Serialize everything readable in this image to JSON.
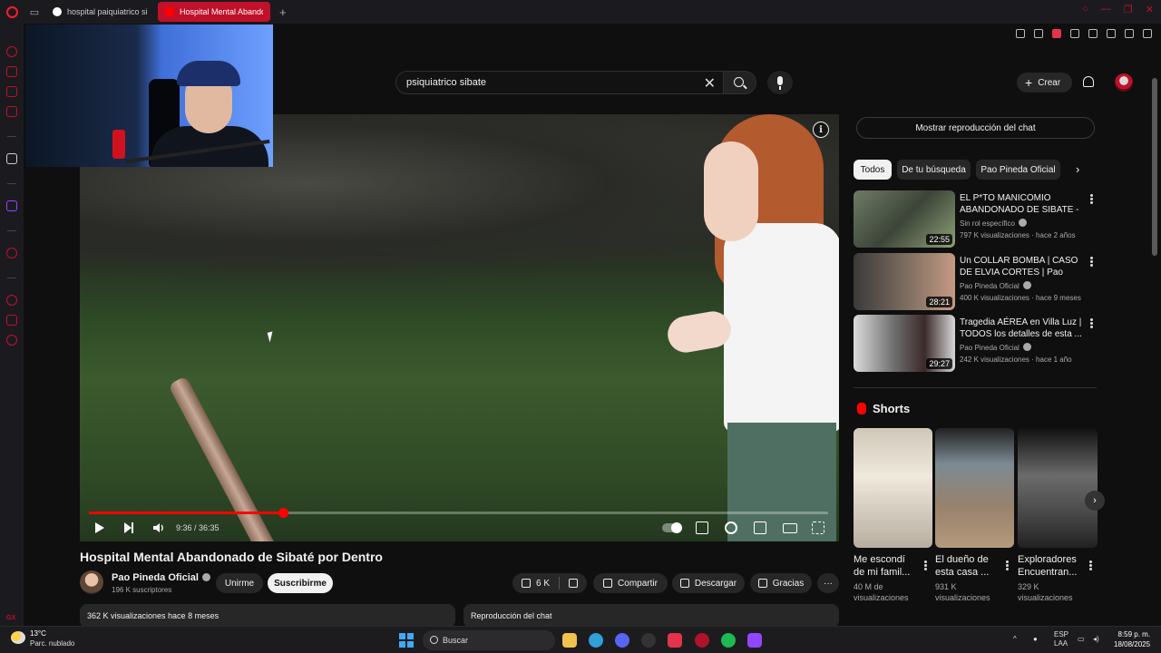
{
  "browser": {
    "tabs": [
      {
        "title": "hospital paiquiatrico siber",
        "active": false
      },
      {
        "title": "Hospital Mental Abandon",
        "active": true
      }
    ],
    "accent": "#c1102a"
  },
  "header": {
    "search_value": "psiquiatrico sibate",
    "create_label": "Crear"
  },
  "player": {
    "time_current": "9:36",
    "time_total": "36:35",
    "time_display": "9:36 / 36:35",
    "progress_fraction": 0.262
  },
  "video": {
    "title": "Hospital Mental Abandonado de Sibaté por Dentro",
    "channel": "Pao Pineda Oficial",
    "subscribers": "196 K suscriptores",
    "join_label": "Unirme",
    "subscribe_label": "Suscribirme",
    "likes": "6 K",
    "share_label": "Compartir",
    "download_label": "Descargar",
    "thanks_label": "Gracias",
    "description_meta": "362 K visualizaciones  hace 8 meses",
    "chat_replay_label": "Reproducción del chat"
  },
  "sidebar_right": {
    "chat_toggle_label": "Mostrar reproducción del chat",
    "chips": [
      "Todos",
      "De tu búsqueda",
      "Pao Pineda Oficial"
    ],
    "recommendations": [
      {
        "title": "EL P*TO MANICOMIO ABANDONADO DE SIBATE - SI...",
        "channel": "Sin rol específico",
        "meta": "797 K visualizaciones · hace 2 años",
        "duration": "22:55"
      },
      {
        "title": "Un COLLAR BOMBA | CASO DE ELVIA CORTES | Pao Pineda",
        "channel": "Pao Pineda Oficial",
        "meta": "400 K visualizaciones · hace 9 meses",
        "duration": "28:21"
      },
      {
        "title": "Tragedia AÉREA en Villa Luz | TODOS los detalles de esta ...",
        "channel": "Pao Pineda Oficial",
        "meta": "242 K visualizaciones · hace 1 año",
        "duration": "29:27"
      }
    ],
    "shorts_title": "Shorts",
    "shorts": [
      {
        "title": "Me escondí de mi famil...",
        "views": "40 M de visualizaciones"
      },
      {
        "title": "El dueño de esta casa ...",
        "views": "931 K visualizaciones"
      },
      {
        "title": "Exploradores Encuentran...",
        "views": "329 K visualizaciones"
      }
    ]
  },
  "taskbar": {
    "temperature": "13°C",
    "condition": "Parc. nublado",
    "search_label": "Buscar",
    "lang_top": "ESP",
    "lang_bottom": "LAA",
    "time": "8:59 p. m.",
    "date": "18/08/2025"
  }
}
